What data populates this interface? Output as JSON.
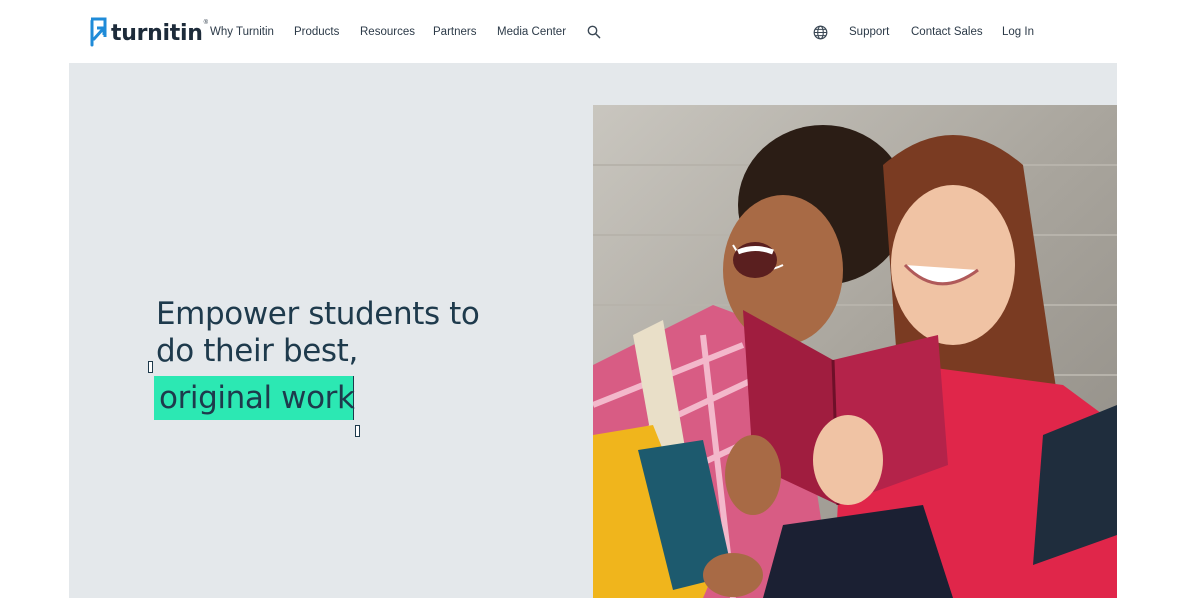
{
  "brand": {
    "name": "turnitin",
    "trademark": "®"
  },
  "nav": {
    "primary": [
      "Why Turnitin",
      "Products",
      "Resources",
      "Partners",
      "Media Center"
    ],
    "search_icon": "search-icon",
    "language_icon": "globe-icon",
    "secondary": [
      "Support",
      "Contact Sales",
      "Log In"
    ]
  },
  "hero": {
    "headline_line1": "Empower students to",
    "headline_line2": "do their best,",
    "highlight_text": "original work",
    "image_alt_icon": "students-reading-photo"
  },
  "colors": {
    "brand_blue": "#1f8bd8",
    "highlight": "#2ce8b3",
    "hero_background": "#e4e8eb",
    "headline": "#1e3a4c"
  }
}
